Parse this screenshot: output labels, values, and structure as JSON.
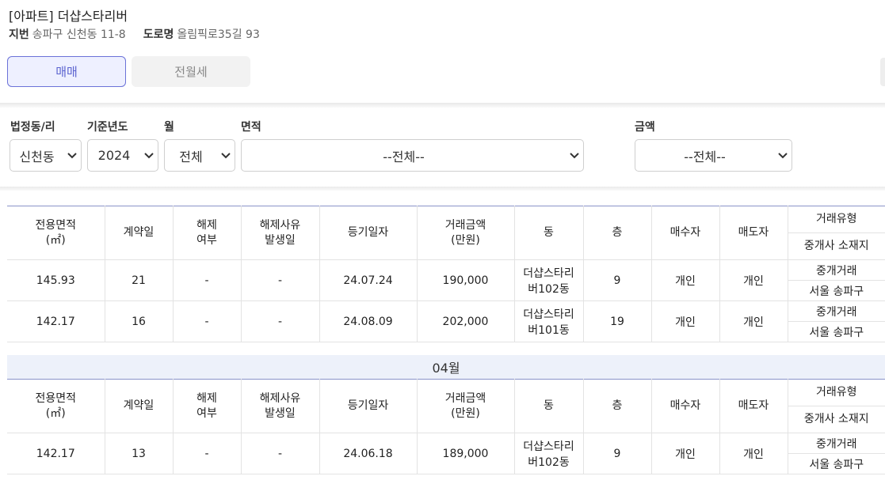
{
  "header": {
    "title": "[아파트] 더샵스타리버",
    "jibun_label": "지번",
    "jibun_value": "송파구 신천동 11-8",
    "road_label": "도로명",
    "road_value": "올림픽로35길 93"
  },
  "tabs": [
    {
      "label": "매매",
      "active": true
    },
    {
      "label": "전월세",
      "active": false
    }
  ],
  "filters": {
    "dong": {
      "label": "법정동/리",
      "value": "신천동"
    },
    "year": {
      "label": "기준년도",
      "value": "2024"
    },
    "month": {
      "label": "월",
      "value": "전체"
    },
    "area": {
      "label": "면적",
      "value": "--전체--"
    },
    "price": {
      "label": "금액",
      "value": "--전체--"
    }
  },
  "table_headers": {
    "area": "전용면적\n(㎡)",
    "contract_day": "계약일",
    "cancel": "해제\n여부",
    "cancel_date": "해제사유\n발생일",
    "reg_date": "등기일자",
    "price": "거래금액\n(만원)",
    "building": "동",
    "floor": "층",
    "buyer": "매수자",
    "seller": "매도자",
    "deal_type": "거래유형",
    "agent_loc": "중개사 소재지"
  },
  "groups": [
    {
      "month": "",
      "rows": [
        {
          "area": "145.93",
          "day": "21",
          "cancel": "-",
          "cancel_date": "-",
          "reg_date": "24.07.24",
          "price": "190,000",
          "building": "더샵스타리\n버102동",
          "floor": "9",
          "buyer": "개인",
          "seller": "개인",
          "deal_type": "중개거래",
          "agent_loc": "서울 송파구"
        },
        {
          "area": "142.17",
          "day": "16",
          "cancel": "-",
          "cancel_date": "-",
          "reg_date": "24.08.09",
          "price": "202,000",
          "building": "더샵스타리\n버101동",
          "floor": "19",
          "buyer": "개인",
          "seller": "개인",
          "deal_type": "중개거래",
          "agent_loc": "서울 송파구"
        }
      ]
    },
    {
      "month": "04월",
      "rows": [
        {
          "area": "142.17",
          "day": "13",
          "cancel": "-",
          "cancel_date": "-",
          "reg_date": "24.06.18",
          "price": "189,000",
          "building": "더샵스타리\n버102동",
          "floor": "9",
          "buyer": "개인",
          "seller": "개인",
          "deal_type": "중개거래",
          "agent_loc": "서울 송파구"
        }
      ]
    }
  ],
  "icons": {
    "select_arrow": "chevron-down-icon"
  },
  "colors": {
    "accent": "#5b63cf",
    "header_line": "#8a93c9",
    "month_band": "#edf1fa"
  }
}
